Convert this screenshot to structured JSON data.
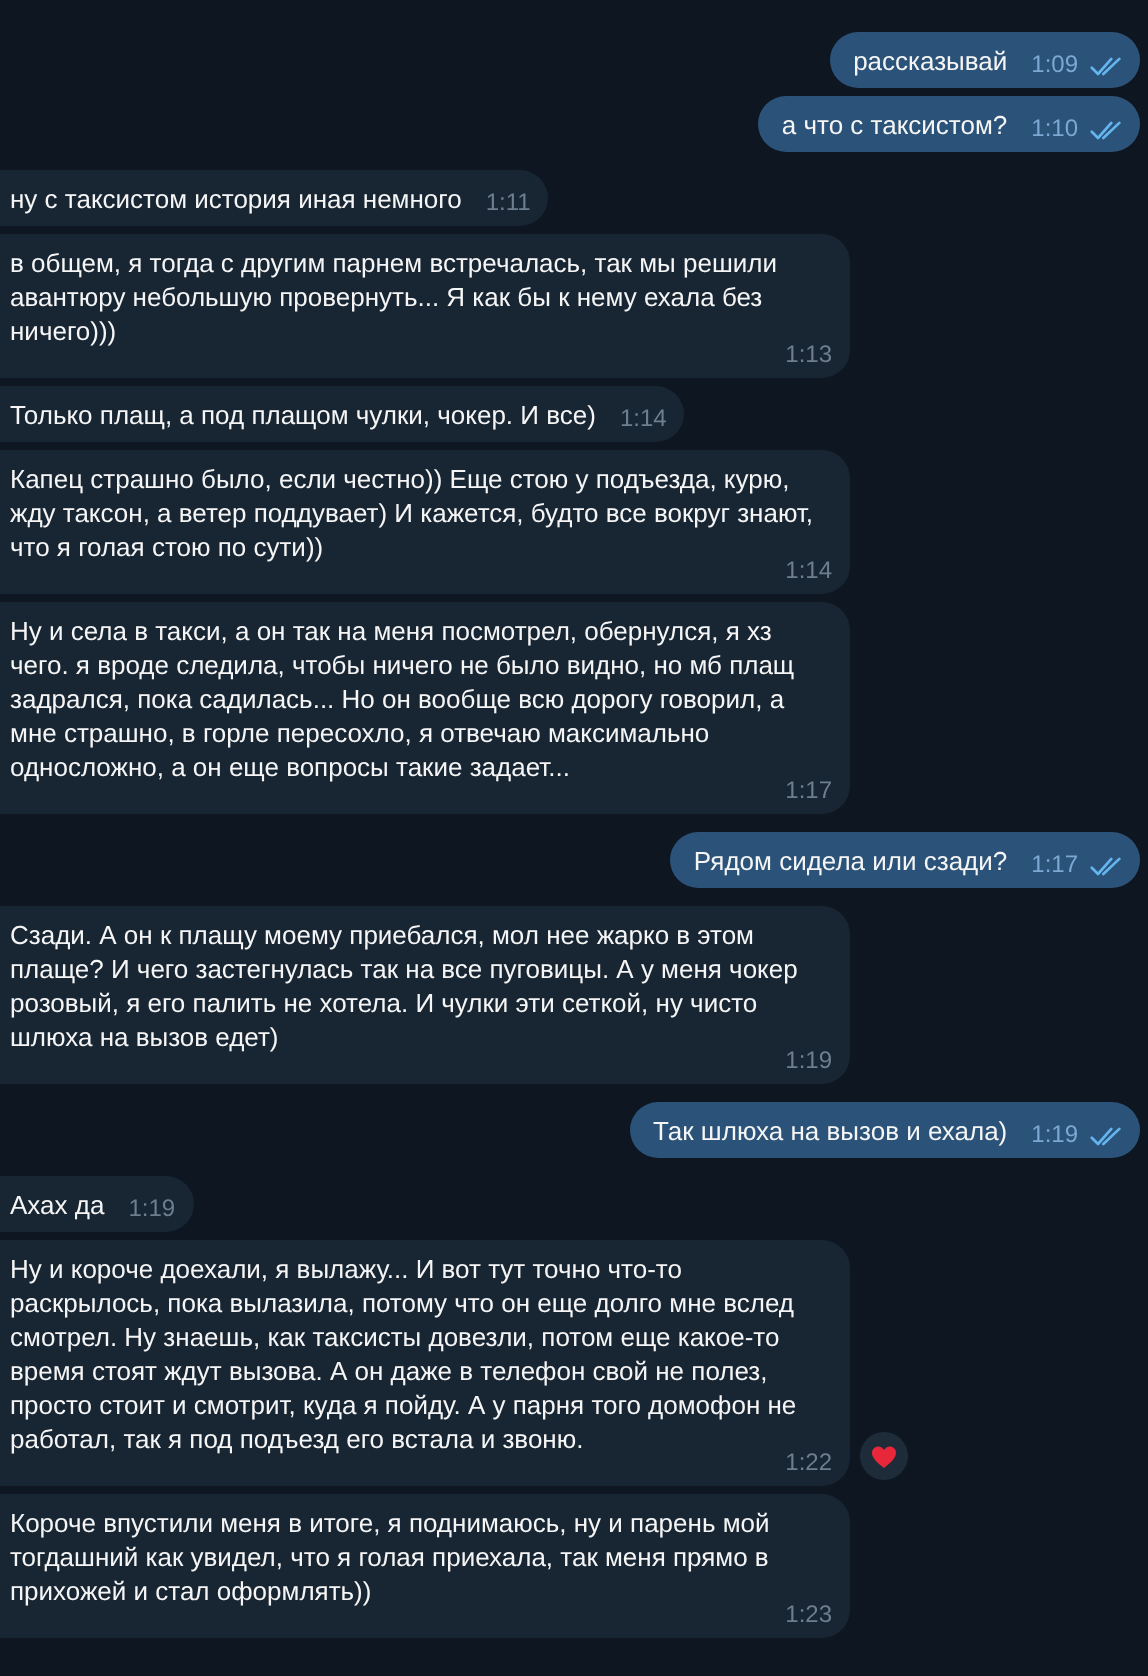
{
  "messages": [
    {
      "kind": "outgoing",
      "text": "рассказывай",
      "time": "1:09",
      "read": true,
      "hearted": false
    },
    {
      "kind": "outgoing",
      "text": "а что с таксистом?",
      "time": "1:10",
      "read": true,
      "hearted": false
    },
    {
      "kind": "incoming",
      "text": "ну с таксистом история иная немного",
      "time": "1:11",
      "hearted": false
    },
    {
      "kind": "incoming",
      "text": "в общем, я тогда с другим парнем встречалась, так мы решили авантюру небольшую провернуть... Я как бы к нему ехала без ничего)))",
      "time": "1:13",
      "hearted": false
    },
    {
      "kind": "incoming",
      "text": "Только плащ, а под плащом чулки, чокер. И все)",
      "time": "1:14",
      "hearted": false
    },
    {
      "kind": "incoming",
      "text": "Капец страшно было, если честно)) Еще стою у подъезда, курю, жду таксон, а ветер поддувает) И кажется, будто все вокруг знают, что я голая стою по сути))",
      "time": "1:14",
      "hearted": false
    },
    {
      "kind": "incoming",
      "text": "Ну и села в такси, а он так на меня посмотрел, обернулся, я хз чего. я вроде следила, чтобы ничего не было видно, но мб плащ задрался, пока садилась... Но он вообще всю дорогу говорил, а мне страшно, в горле пересохло, я отвечаю максимально односложно, а он еще вопросы такие задает...",
      "time": "1:17",
      "hearted": false
    },
    {
      "kind": "outgoing",
      "text": "Рядом сидела или сзади?",
      "time": "1:17",
      "read": true,
      "hearted": false
    },
    {
      "kind": "incoming",
      "text": "Сзади. А он к плащу моему приебался, мол нее жарко в этом плаще? И чего застегнулась так на все пуговицы. А у меня чокер розовый, я его палить не хотела. И чулки эти сеткой, ну чисто шлюха на вызов едет)",
      "time": "1:19",
      "hearted": false
    },
    {
      "kind": "outgoing",
      "text": "Так шлюха на вызов и ехала)",
      "time": "1:19",
      "read": true,
      "hearted": false
    },
    {
      "kind": "incoming",
      "text": "Ахах да",
      "time": "1:19",
      "hearted": false
    },
    {
      "kind": "incoming",
      "text": "Ну и короче доехали, я вылажу... И вот тут точно что-то раскрылось, пока вылазила, потому что он еще долго мне вслед смотрел. Ну знаешь, как таксисты довезли, потом еще какое-то время стоят ждут вызова. А он даже в телефон свой не полез, просто стоит и смотрит, куда я пойду. А у парня того домофон не работал, так я под подъезд его встала и звоню.",
      "time": "1:22",
      "hearted": true
    },
    {
      "kind": "incoming",
      "text": "Короче впустили меня в итоге, я поднимаюсь, ну и парень мой тогдашний как увидел, что я голая приехала, так меня прямо в прихожей и стал оформлять))",
      "time": "1:23",
      "hearted": false
    }
  ]
}
